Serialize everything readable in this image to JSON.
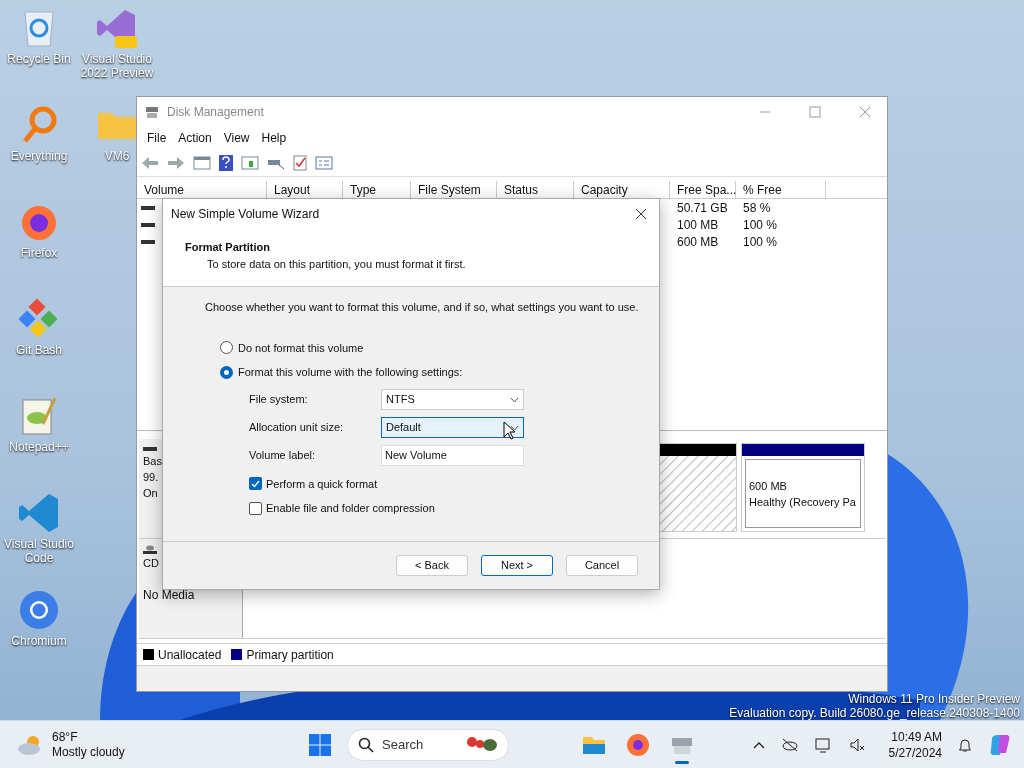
{
  "desktop_icons": [
    {
      "label": "Recycle Bin",
      "kind": "recycle"
    },
    {
      "label": "Visual Studio 2022 Preview",
      "kind": "vs"
    },
    {
      "label": "Everything",
      "kind": "everything"
    },
    {
      "label": "VM6",
      "kind": "folder"
    },
    {
      "label": "Firefox",
      "kind": "firefox"
    },
    {
      "label": "Git Bash",
      "kind": "git"
    },
    {
      "label": "Notepad++",
      "kind": "notepad"
    },
    {
      "label": "Visual Studio Code",
      "kind": "vscode"
    },
    {
      "label": "Chromium",
      "kind": "chromium"
    }
  ],
  "watermark_lines": [
    "Windows 11 Pro Insider Preview",
    "Evaluation copy. Build 26080.ge_release.240308-1400"
  ],
  "disk_management": {
    "title": "Disk Management",
    "menu": [
      "File",
      "Action",
      "View",
      "Help"
    ],
    "columns": [
      "Volume",
      "Layout",
      "Type",
      "File System",
      "Status",
      "Capacity",
      "Free Spa...",
      "% Free"
    ],
    "rows": [
      {
        "free_space": "50.71 GB",
        "percent_free": "58 %"
      },
      {
        "free_space": "100 MB",
        "percent_free": "100 %"
      },
      {
        "free_space": "600 MB",
        "percent_free": "100 %"
      }
    ],
    "disks": [
      {
        "kind": "disk",
        "label_lines": [
          "Bas",
          "99.",
          "On"
        ],
        "partitions": [
          {
            "kind": "unallocated"
          },
          {
            "kind": "primary",
            "lines": [
              "600 MB",
              "Healthy (Recovery Pa"
            ]
          }
        ]
      },
      {
        "kind": "cd",
        "label_lines": [
          "CD"
        ],
        "status": "No Media"
      }
    ],
    "legend": [
      {
        "label": "Unallocated",
        "color": "#000000"
      },
      {
        "label": "Primary partition",
        "color": "#000080"
      }
    ]
  },
  "wizard": {
    "title": "New Simple Volume Wizard",
    "heading": "Format Partition",
    "subtitle": "To store data on this partition, you must format it first.",
    "instruction": "Choose whether you want to format this volume, and if so, what settings you want to use.",
    "options": [
      {
        "label": "Do not format this volume",
        "selected": false
      },
      {
        "label": "Format this volume with the following settings:",
        "selected": true
      }
    ],
    "fields": [
      {
        "label": "File system:",
        "value": "NTFS",
        "kind": "dropdown",
        "focused": false
      },
      {
        "label": "Allocation unit size:",
        "value": "Default",
        "kind": "dropdown",
        "focused": true
      },
      {
        "label": "Volume label:",
        "value": "New Volume",
        "kind": "text",
        "focused": false
      }
    ],
    "checkboxes": [
      {
        "label": "Perform a quick format",
        "checked": true
      },
      {
        "label": "Enable file and folder compression",
        "checked": false
      }
    ],
    "buttons": [
      {
        "label": "< Back",
        "primary": false
      },
      {
        "label": "Next >",
        "primary": true
      },
      {
        "label": "Cancel",
        "primary": false
      }
    ]
  },
  "taskbar": {
    "weather": {
      "temperature": "68°F",
      "condition": "Mostly cloudy"
    },
    "search_placeholder": "Search",
    "apps": [
      {
        "kind": "explorer",
        "selected": false
      },
      {
        "kind": "firefox",
        "selected": false
      },
      {
        "kind": "diskmgmt",
        "selected": true
      }
    ],
    "time": "10:49 AM",
    "date": "5/27/2024"
  }
}
